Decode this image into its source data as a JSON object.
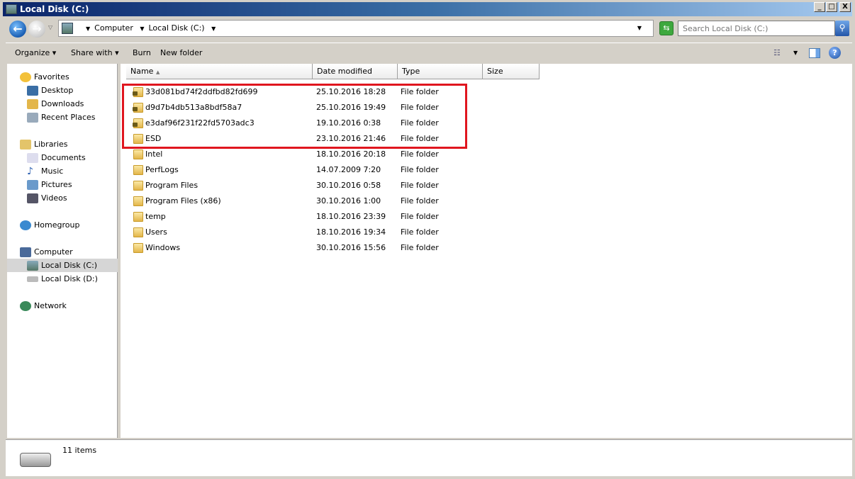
{
  "window": {
    "title": "Local Disk (C:)",
    "minimize": "_",
    "maximize": "□",
    "close": "X"
  },
  "address": {
    "crumbs": [
      "Computer",
      "Local Disk (C:)"
    ],
    "search_placeholder": "Search Local Disk (C:)"
  },
  "toolbar": {
    "organize": "Organize ▾",
    "share_with": "Share with ▾",
    "burn": "Burn",
    "new_folder": "New folder"
  },
  "sidebar": {
    "favorites": {
      "label": "Favorites",
      "items": [
        "Desktop",
        "Downloads",
        "Recent Places"
      ]
    },
    "libraries": {
      "label": "Libraries",
      "items": [
        "Documents",
        "Music",
        "Pictures",
        "Videos"
      ]
    },
    "homegroup": "Homegroup",
    "computer": {
      "label": "Computer",
      "items": [
        "Local Disk (C:)",
        "Local Disk (D:)"
      ],
      "selected": "Local Disk (C:)"
    },
    "network": "Network"
  },
  "columns": {
    "name": "Name",
    "date": "Date modified",
    "type": "Type",
    "size": "Size"
  },
  "files": [
    {
      "name": "33d081bd74f2ddfbd82fd699",
      "date": "25.10.2016 18:28",
      "type": "File folder",
      "locked": true
    },
    {
      "name": "d9d7b4db513a8bdf58a7",
      "date": "25.10.2016 19:49",
      "type": "File folder",
      "locked": true
    },
    {
      "name": "e3daf96f231f22fd5703adc3",
      "date": "19.10.2016 0:38",
      "type": "File folder",
      "locked": true
    },
    {
      "name": "ESD",
      "date": "23.10.2016 21:46",
      "type": "File folder",
      "locked": false
    },
    {
      "name": "Intel",
      "date": "18.10.2016 20:18",
      "type": "File folder",
      "locked": false
    },
    {
      "name": "PerfLogs",
      "date": "14.07.2009 7:20",
      "type": "File folder",
      "locked": false
    },
    {
      "name": "Program Files",
      "date": "30.10.2016 0:58",
      "type": "File folder",
      "locked": false
    },
    {
      "name": "Program Files (x86)",
      "date": "30.10.2016 1:00",
      "type": "File folder",
      "locked": false
    },
    {
      "name": "temp",
      "date": "18.10.2016 23:39",
      "type": "File folder",
      "locked": false
    },
    {
      "name": "Users",
      "date": "18.10.2016 19:34",
      "type": "File folder",
      "locked": false
    },
    {
      "name": "Windows",
      "date": "30.10.2016 15:56",
      "type": "File folder",
      "locked": false
    }
  ],
  "status": {
    "count": "11 items"
  },
  "colors": {
    "highlight": "#e0161f"
  }
}
